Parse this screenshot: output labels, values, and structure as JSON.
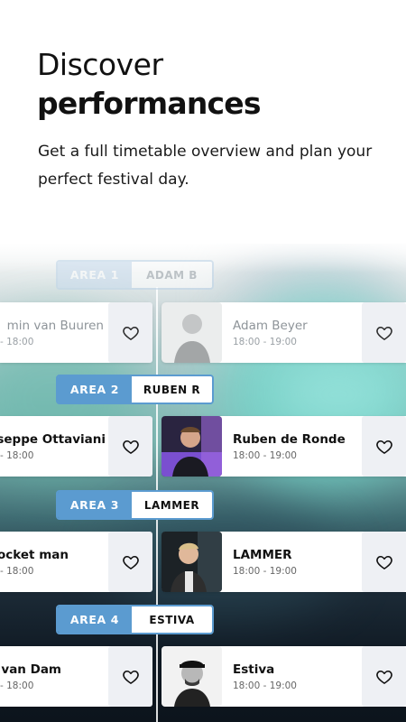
{
  "header": {
    "title_light": "Discover",
    "title_bold": "performances",
    "subtitle": "Get a full timetable overview and plan your perfect festival day."
  },
  "colors": {
    "accent": "#5b9bd0",
    "fav_bg": "#eef0f4",
    "bg_teal": "#7fb6b2",
    "bg_dark": "#0c141c"
  },
  "rows": [
    {
      "area": "AREA 1",
      "area_name": "ADAM B",
      "left": {
        "name": "min van Buuren",
        "time": "- 18:00"
      },
      "right": {
        "name": "Adam Beyer",
        "time": "18:00 - 19:00",
        "photo_icon": "artist-portrait-icon"
      }
    },
    {
      "area": "AREA 2",
      "area_name": "RUBEN R",
      "left": {
        "name": "seppe Ottaviani",
        "time": "- 18:00"
      },
      "right": {
        "name": "Ruben de Ronde",
        "time": "18:00 - 19:00",
        "photo_icon": "artist-portrait-icon"
      }
    },
    {
      "area": "AREA 3",
      "area_name": "LAMMER",
      "left": {
        "name": "Rocket man",
        "time": "- 18:00"
      },
      "right": {
        "name": "LAMMER",
        "time": "18:00 - 19:00",
        "photo_icon": "artist-portrait-icon"
      }
    },
    {
      "area": "AREA 4",
      "area_name": "ESTIVA",
      "left": {
        "name": "ra van Dam",
        "time": "- 18:00"
      },
      "right": {
        "name": "Estiva",
        "time": "18:00 - 19:00",
        "photo_icon": "artist-portrait-icon"
      }
    }
  ],
  "icons": {
    "favorite": "heart-outline-icon"
  }
}
